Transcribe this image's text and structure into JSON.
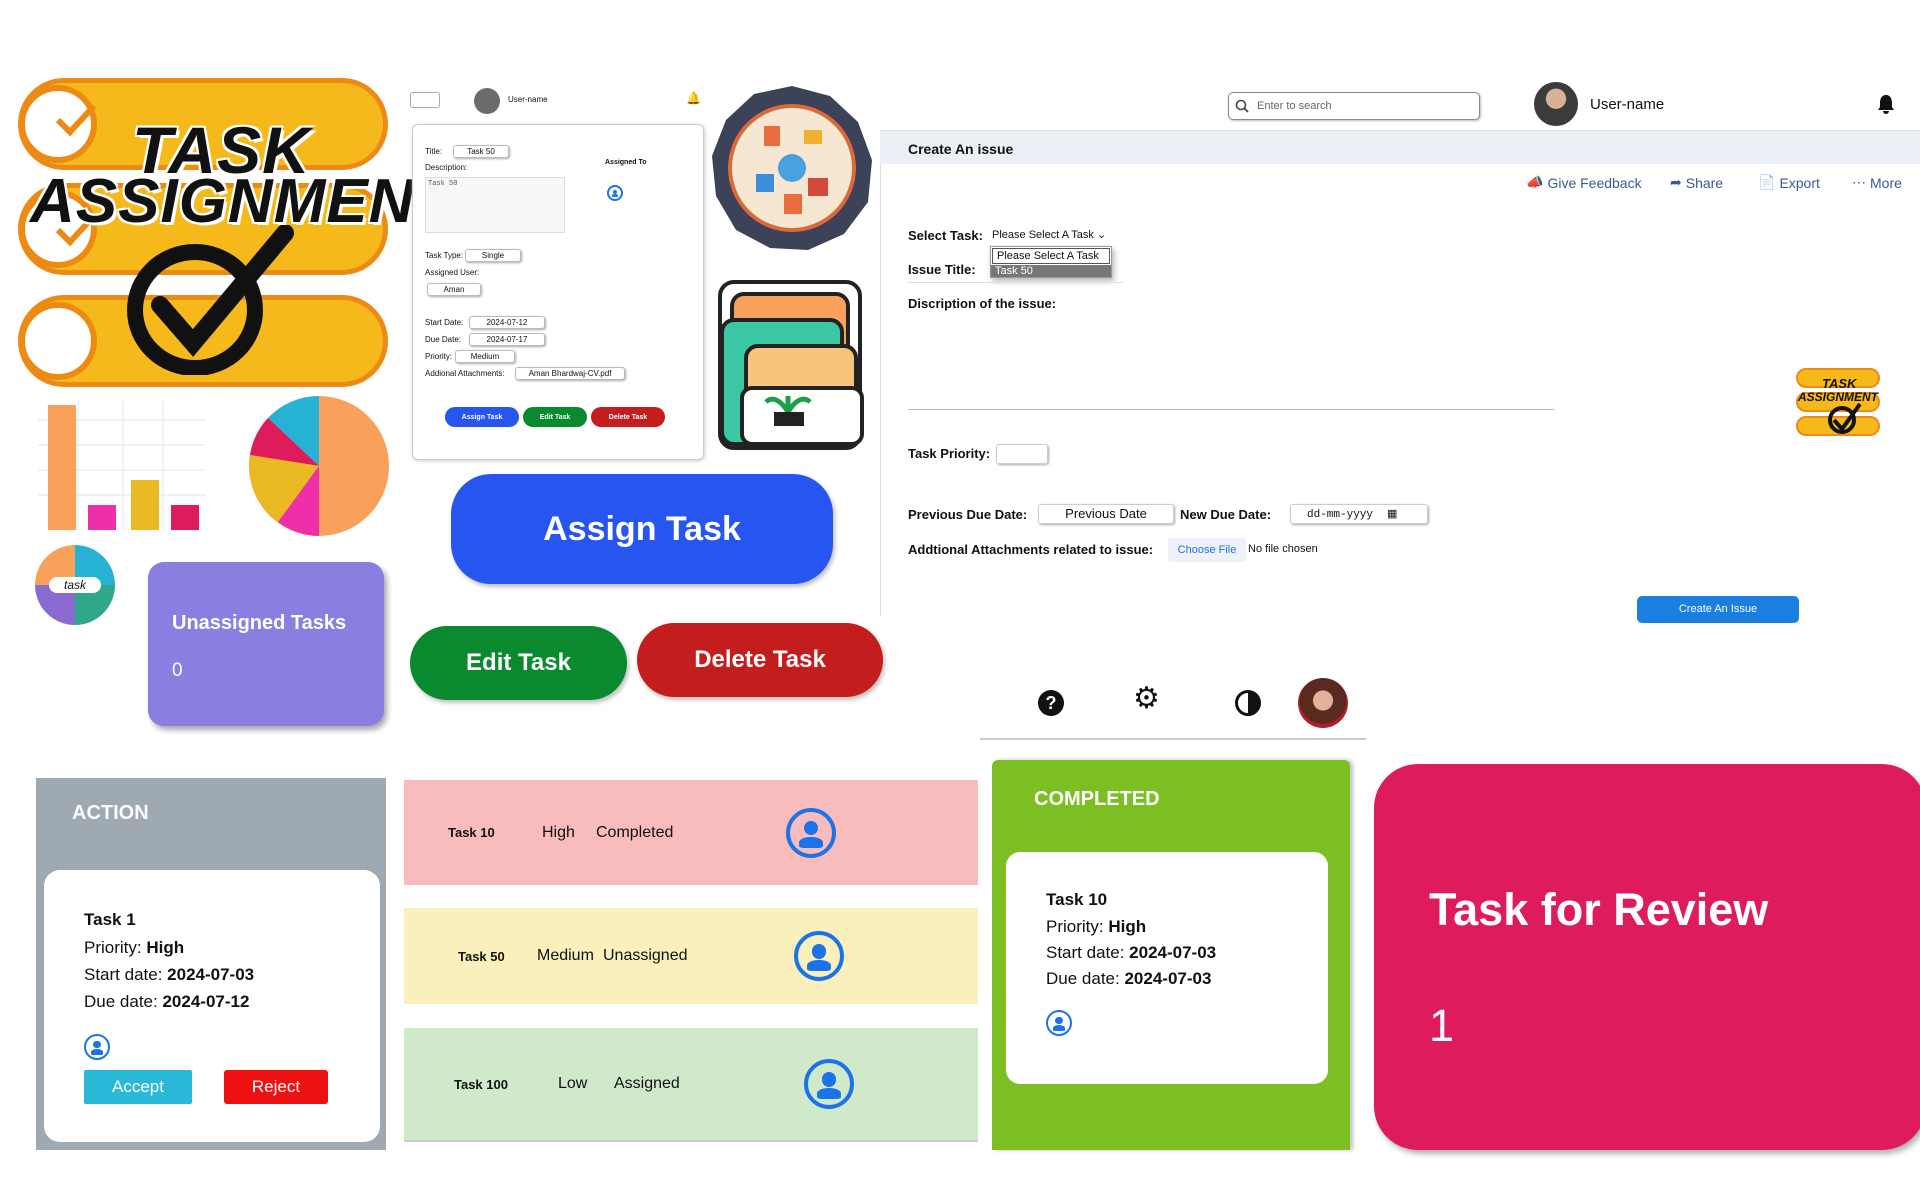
{
  "logo": {
    "line1": "TASK",
    "line2": "ASSIGNMENT"
  },
  "header_small": {
    "user_name": "User-name"
  },
  "assign_form": {
    "title_label": "Title:",
    "title_value": "Task 50",
    "description_label": "Description:",
    "description_value": "Task 50",
    "assigned_to_label": "Assigned To",
    "task_type_label": "Task Type:",
    "task_type_value": "Single",
    "assigned_user_label": "Assigned User:",
    "assigned_user_value": "Aman",
    "start_date_label": "Start Date:",
    "start_date_value": "2024-07-12",
    "due_date_label": "Due Date:",
    "due_date_value": "2024-07-17",
    "priority_label": "Priority:",
    "priority_value": "Medium",
    "attachments_label": "Addional Attachments:",
    "attachments_value": "Aman Bhardwaj-CV.pdf",
    "btn_assign": "Assign Task",
    "btn_edit": "Edit Task",
    "btn_delete": "Delete Task"
  },
  "big_buttons": {
    "assign": "Assign Task",
    "edit": "Edit Task",
    "delete": "Delete Task"
  },
  "small_logo": {
    "text": "task"
  },
  "unassigned_card": {
    "title": "Unassigned Tasks",
    "count": "0"
  },
  "issue_page": {
    "search_placeholder": "Enter to search",
    "user_name": "User-name",
    "heading": "Create An issue",
    "menu": [
      "Give Feedback",
      "Share",
      "Export",
      "More"
    ],
    "select_task_label": "Select Task:",
    "select_task_value": "Please Select A Task",
    "dropdown_options": [
      "Please Select A Task",
      "Task 50"
    ],
    "issue_title_label": "Issue Title:",
    "description_label": "Discription of the issue:",
    "priority_label": "Task Priority:",
    "prev_due_label": "Previous Due Date:",
    "prev_due_value": "Previous Date",
    "new_due_label": "New Due Date:",
    "new_due_placeholder": "dd-mm-yyyy",
    "attachments_label": "Addtional Attachments related to issue:",
    "choose_file": "Choose File",
    "no_file": "No file chosen",
    "submit": "Create An Issue",
    "mini_logo_line1": "TASK",
    "mini_logo_line2": "ASSIGNMENT"
  },
  "action_card": {
    "header": "ACTION",
    "task": "Task 1",
    "priority_label": "Priority:",
    "priority": "High",
    "start_label": "Start date:",
    "start": "2024-07-03",
    "due_label": "Due date:",
    "due": "2024-07-12",
    "accept": "Accept",
    "reject": "Reject"
  },
  "task_rows": [
    {
      "name": "Task 10",
      "priority": "High",
      "status": "Completed",
      "color": "#f9bcbc"
    },
    {
      "name": "Task 50",
      "priority": "Medium",
      "status": "Unassigned",
      "color": "#f9f0bb"
    },
    {
      "name": "Task 100",
      "priority": "Low",
      "status": "Assigned",
      "color": "#d0e9cb"
    }
  ],
  "completed_card": {
    "header": "COMPLETED",
    "task": "Task 10",
    "priority_label": "Priority:",
    "priority": "High",
    "start_label": "Start date:",
    "start": "2024-07-03",
    "due_label": "Due date:",
    "due": "2024-07-03"
  },
  "review_card": {
    "title": "Task for Review",
    "count": "1"
  },
  "colors": {
    "blue": "#2655f0",
    "green": "#0a8a2e",
    "red": "#c41d1d",
    "purple": "#8a7ee0",
    "completed": "#7bbf22",
    "review": "#df1c5b",
    "action_header": "#9ea9b2",
    "accept": "#29b8d8",
    "reject": "#ee1111"
  }
}
